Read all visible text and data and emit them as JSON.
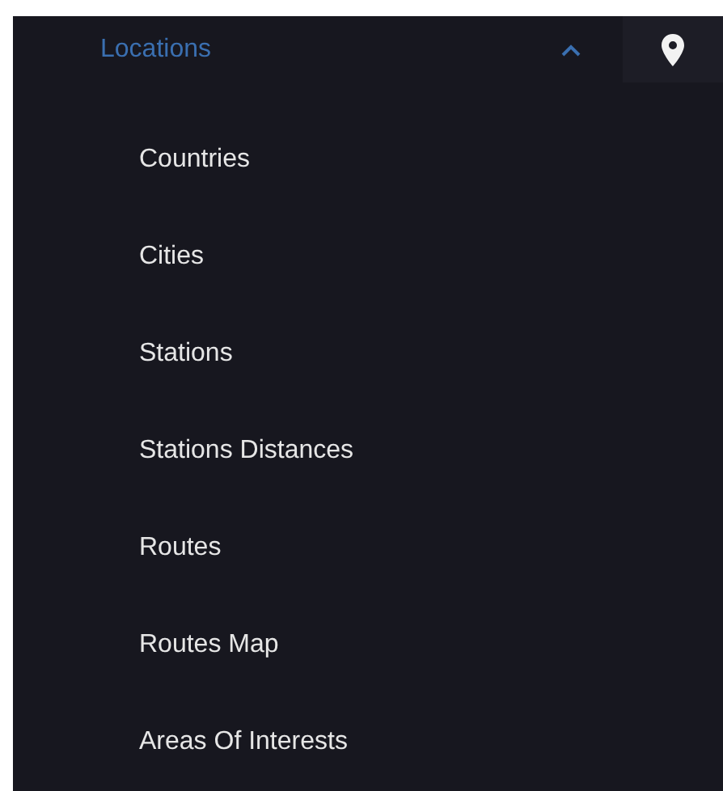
{
  "menu": {
    "label": "Locations",
    "expanded": true,
    "items": [
      {
        "label": "Countries"
      },
      {
        "label": "Cities"
      },
      {
        "label": "Stations"
      },
      {
        "label": "Stations Distances"
      },
      {
        "label": "Routes"
      },
      {
        "label": "Routes Map"
      },
      {
        "label": "Areas Of Interests"
      }
    ]
  }
}
